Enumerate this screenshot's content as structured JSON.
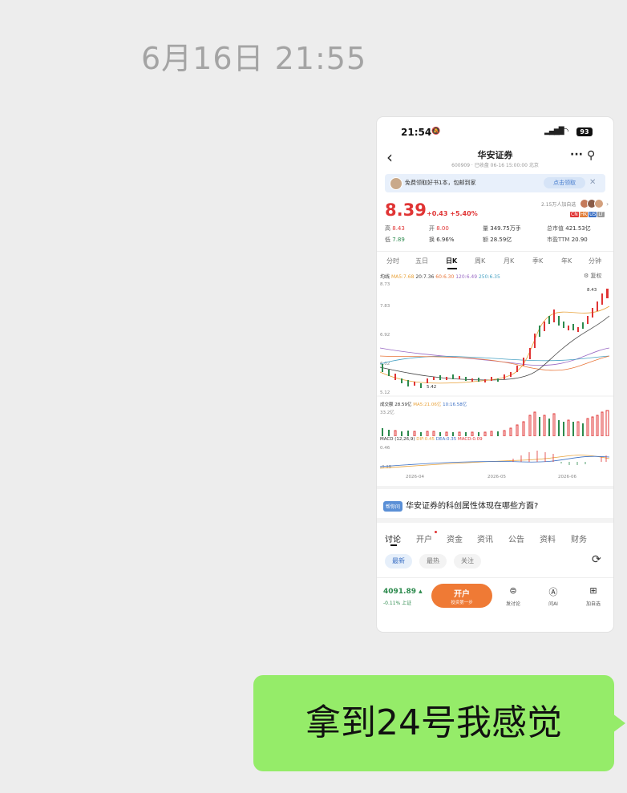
{
  "timestamp": "6月16日 21:55",
  "phone": {
    "status": {
      "time": "21:54",
      "battery": "93"
    },
    "header": {
      "name": "华安证券",
      "sub": "600909 · 已收盘 06-16 15:00:00 北京"
    },
    "banner": {
      "text": "免费领取好书1本，包邮到家",
      "button": "点击领取"
    },
    "quote": {
      "price": "8.39",
      "change": "+0.43",
      "change_pct": "+5.40%",
      "follow": "2.15万人加自选",
      "high_label": "高",
      "high": "8.43",
      "open_label": "开",
      "open": "8.00",
      "vol_label": "量",
      "vol": "349.75万手",
      "mcap_label": "总市值",
      "mcap": "421.53亿",
      "low_label": "低",
      "low": "7.89",
      "turn_label": "换",
      "turn": "6.96%",
      "amt_label": "额",
      "amt": "28.59亿",
      "pe_label": "市盈TTM",
      "pe": "20.90"
    },
    "period_tabs": [
      "分时",
      "五日",
      "日K",
      "周K",
      "月K",
      "季K",
      "年K",
      "分钟"
    ],
    "legend": {
      "title": "均线",
      "ma5": "MA5:7.68",
      "ma20": "20:7.36",
      "ma60": "60:6.30",
      "ma120": "120:6.49",
      "ma250": "250:6.35",
      "settings": "复权"
    },
    "price_axis": [
      "8.73",
      "7.83",
      "6.92",
      "6.02",
      "5.12"
    ],
    "annotations": {
      "high": "8.43",
      "low": "5.42"
    },
    "volume_legend": {
      "title": "成交额",
      "v1": "28.59亿",
      "v2": "MA5:21.06亿",
      "v3": "10:16.58亿",
      "axis": "33.2亿"
    },
    "macd_legend": {
      "title": "MACD",
      "params": "(12,26,9)",
      "dif": "DIF:0.45",
      "dea": "DEA:0.35",
      "macd": "MACD:0.09",
      "axis_top": "0.46",
      "axis_bot": "-0.25"
    },
    "dates": [
      "2026-04",
      "2026-05",
      "2026-06"
    ],
    "section": {
      "tag": "帮你问",
      "title": "华安证券的科创属性体现在哪些方面?"
    },
    "bottom_tabs": [
      "讨论",
      "开户",
      "资金",
      "资讯",
      "公告",
      "资料",
      "财务"
    ],
    "chips": [
      "最新",
      "最热",
      "关注"
    ],
    "bottom_bar": {
      "index": "4091.89",
      "index_change": "-0.11%  上证",
      "open_main": "开户",
      "open_sub": "投资第一步",
      "discuss": "发讨论",
      "ask": "问AI",
      "add": "加自选"
    },
    "colors": {
      "up": "#e03434",
      "down": "#2c8a4d",
      "accent": "#ef7a35"
    }
  },
  "bubble": {
    "text": "拿到24号我感觉"
  }
}
